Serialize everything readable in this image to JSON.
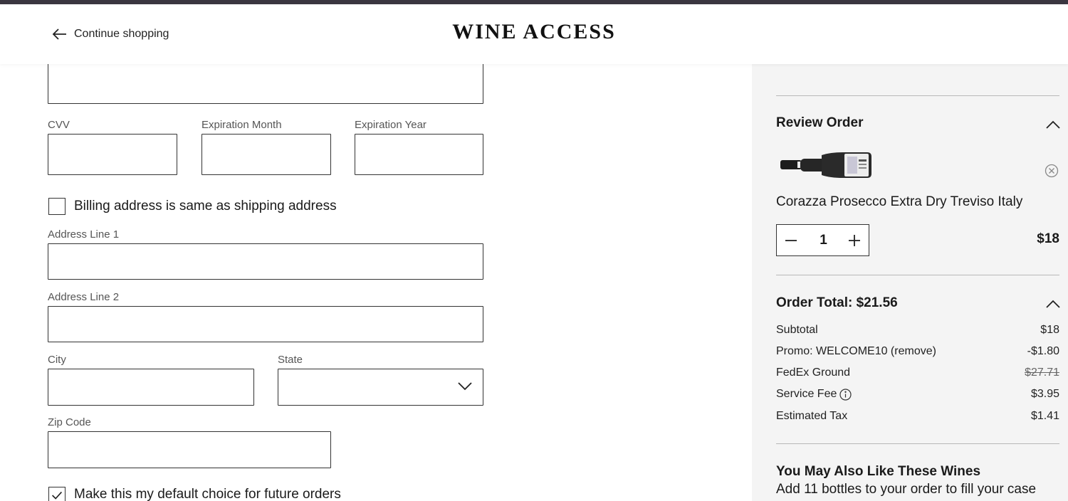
{
  "header": {
    "continue_label": "Continue shopping",
    "logo_text": "WINE ACCESS"
  },
  "payment": {
    "cvv_label": "CVV",
    "exp_month_label": "Expiration Month",
    "exp_year_label": "Expiration Year",
    "card_number_value": "",
    "cvv_value": "",
    "exp_month_value": "",
    "exp_year_value": ""
  },
  "billing": {
    "same_as_shipping_label": "Billing address is same as shipping address",
    "same_as_shipping_checked": false,
    "address1_label": "Address Line 1",
    "address2_label": "Address Line 2",
    "city_label": "City",
    "state_label": "State",
    "zip_label": "Zip Code",
    "address1_value": "",
    "address2_value": "",
    "city_value": "",
    "state_value": "",
    "zip_value": "",
    "default_choice_label": "Make this my default choice for future orders",
    "default_choice_checked": true
  },
  "review": {
    "title": "Review Order",
    "product_name": "Corazza Prosecco Extra Dry Treviso Italy",
    "quantity": "1",
    "price": "$18"
  },
  "order_total": {
    "title": "Order Total: $21.56",
    "rows": [
      {
        "label": "Subtotal",
        "value": "$18"
      },
      {
        "label": "Promo: WELCOME10 (remove)",
        "value": "-$1.80"
      },
      {
        "label": "FedEx Ground",
        "value": "$27.71"
      },
      {
        "label": "Service Fee",
        "value": "$3.95"
      },
      {
        "label": "Estimated Tax",
        "value": "$1.41"
      }
    ]
  },
  "also_like": {
    "title": "You May Also Like These Wines",
    "subtitle": "Add 11 bottles to your order to fill your case"
  },
  "colors": {
    "topbar": "#3a3640",
    "sidebar_bg": "#f4f4f4",
    "border": "#333333"
  }
}
